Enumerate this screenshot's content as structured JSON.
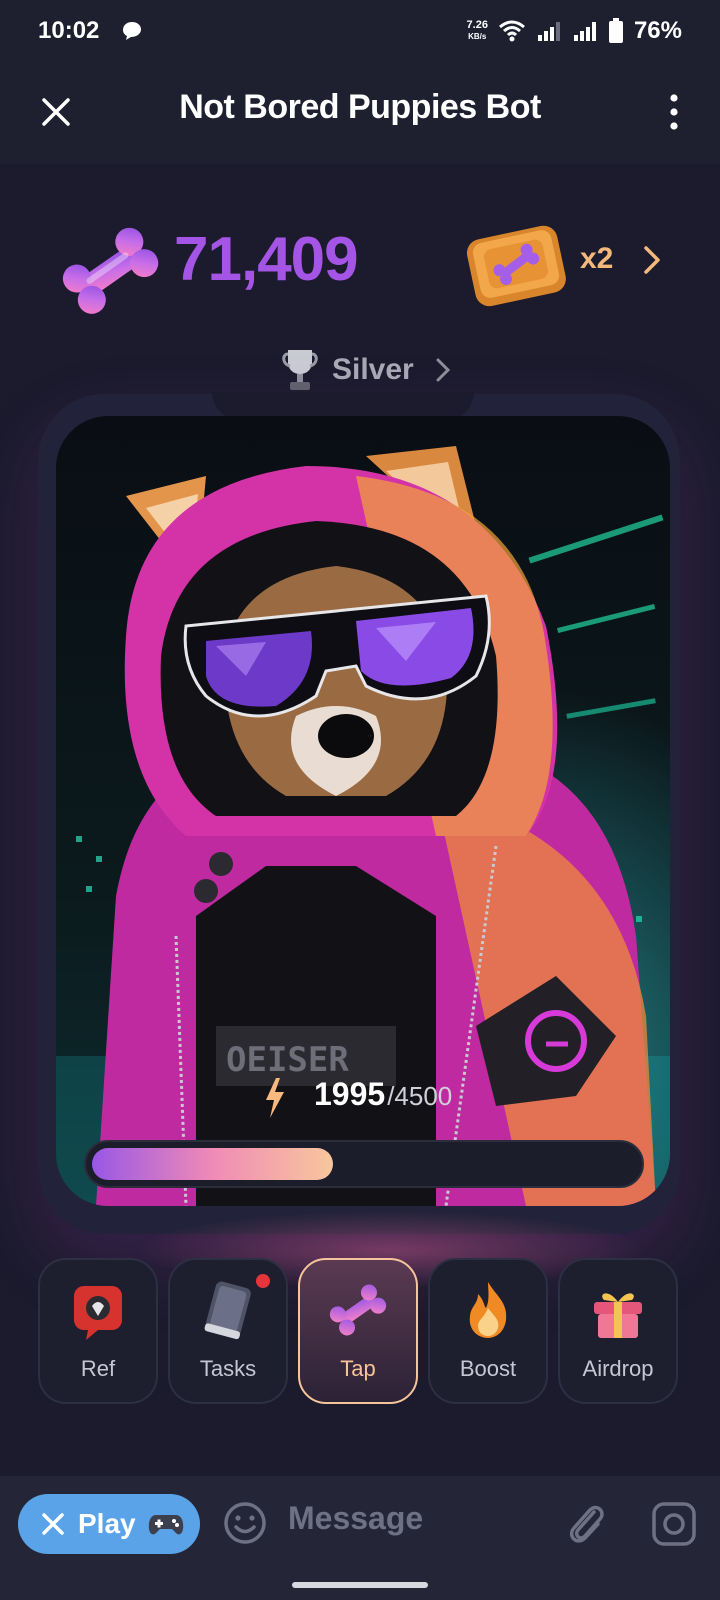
{
  "status_bar": {
    "time": "10:02",
    "net_speed": "7.26",
    "net_speed_unit": "KB/s",
    "battery": "76%"
  },
  "header": {
    "title": "Not Bored Puppies Bot"
  },
  "game": {
    "balance": "71,409",
    "multiplier": "x2",
    "league": "Silver",
    "energy_current": "1995",
    "energy_max": "/4500",
    "energy_fraction": 0.443
  },
  "nav": {
    "items": [
      {
        "label": "Ref",
        "icon": "ref-icon",
        "active": false,
        "notify": false
      },
      {
        "label": "Tasks",
        "icon": "tasks-icon",
        "active": false,
        "notify": true
      },
      {
        "label": "Tap",
        "icon": "bone-icon",
        "active": true,
        "notify": false
      },
      {
        "label": "Boost",
        "icon": "fire-icon",
        "active": false,
        "notify": false
      },
      {
        "label": "Airdrop",
        "icon": "gift-icon",
        "active": false,
        "notify": false
      }
    ]
  },
  "message_bar": {
    "play_label": "Play",
    "placeholder": "Message"
  },
  "colors": {
    "balance": "#a555e6",
    "multiplier": "#f2b97a",
    "active_nav": "#f6c49a",
    "play_button": "#5aa3e8",
    "notify_dot": "#e5353b"
  }
}
